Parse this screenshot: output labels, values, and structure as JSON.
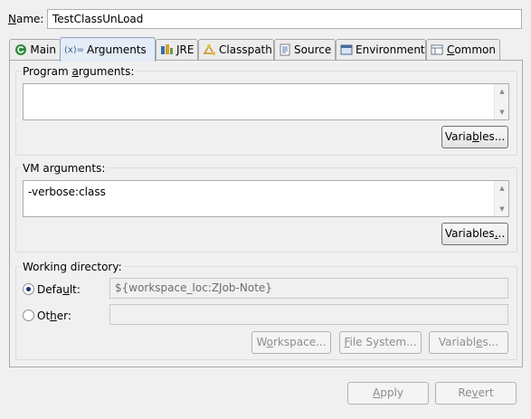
{
  "name_row": {
    "label_first": "N",
    "label_rest": "ame:",
    "value": "TestClassUnLoad"
  },
  "tabs": [
    {
      "label": "Main",
      "icon": "main-tab-icon"
    },
    {
      "label": "Arguments",
      "icon": "arguments-tab-icon",
      "prefix": "(x)="
    },
    {
      "label": "JRE",
      "icon": "jre-tab-icon"
    },
    {
      "label": "Classpath",
      "icon": "classpath-tab-icon"
    },
    {
      "label": "Source",
      "icon": "source-tab-icon"
    },
    {
      "label": "Environment",
      "icon": "environment-tab-icon"
    },
    {
      "label_first": "C",
      "label_rest": "ommon",
      "icon": "common-tab-icon"
    }
  ],
  "program_args": {
    "title_a": "Program ",
    "title_u": "a",
    "title_b": "rguments:",
    "value": "",
    "variables_a": "Varia",
    "variables_u": "b",
    "variables_b": "les..."
  },
  "vm_args": {
    "title_a": "VM ar",
    "title_u": "g",
    "title_b": "uments:",
    "value": "-verbose:class",
    "variables_a": "Variables",
    "variables_u": ".",
    "variables_b": ".."
  },
  "working_dir": {
    "title": "Working directory:",
    "default_a": "Defa",
    "default_u": "u",
    "default_b": "lt:",
    "default_value": "${workspace_loc:ZJob-Note}",
    "other_a": "Ot",
    "other_u": "h",
    "other_b": "er:",
    "other_value": "",
    "workspace_a": "W",
    "workspace_u": "o",
    "workspace_b": "rkspace...",
    "filesystem_a": "",
    "filesystem_u": "F",
    "filesystem_b": "ile System...",
    "variables_a": "Variabl",
    "variables_u": "e",
    "variables_b": "s..."
  },
  "footer": {
    "apply_u": "A",
    "apply_b": "pply",
    "revert_a": "Re",
    "revert_u": "v",
    "revert_b": "ert"
  },
  "colors": {
    "active_tab": "#e4ecf7",
    "window_bg": "#f0f0f0",
    "radio_dot": "#1b2f70"
  }
}
